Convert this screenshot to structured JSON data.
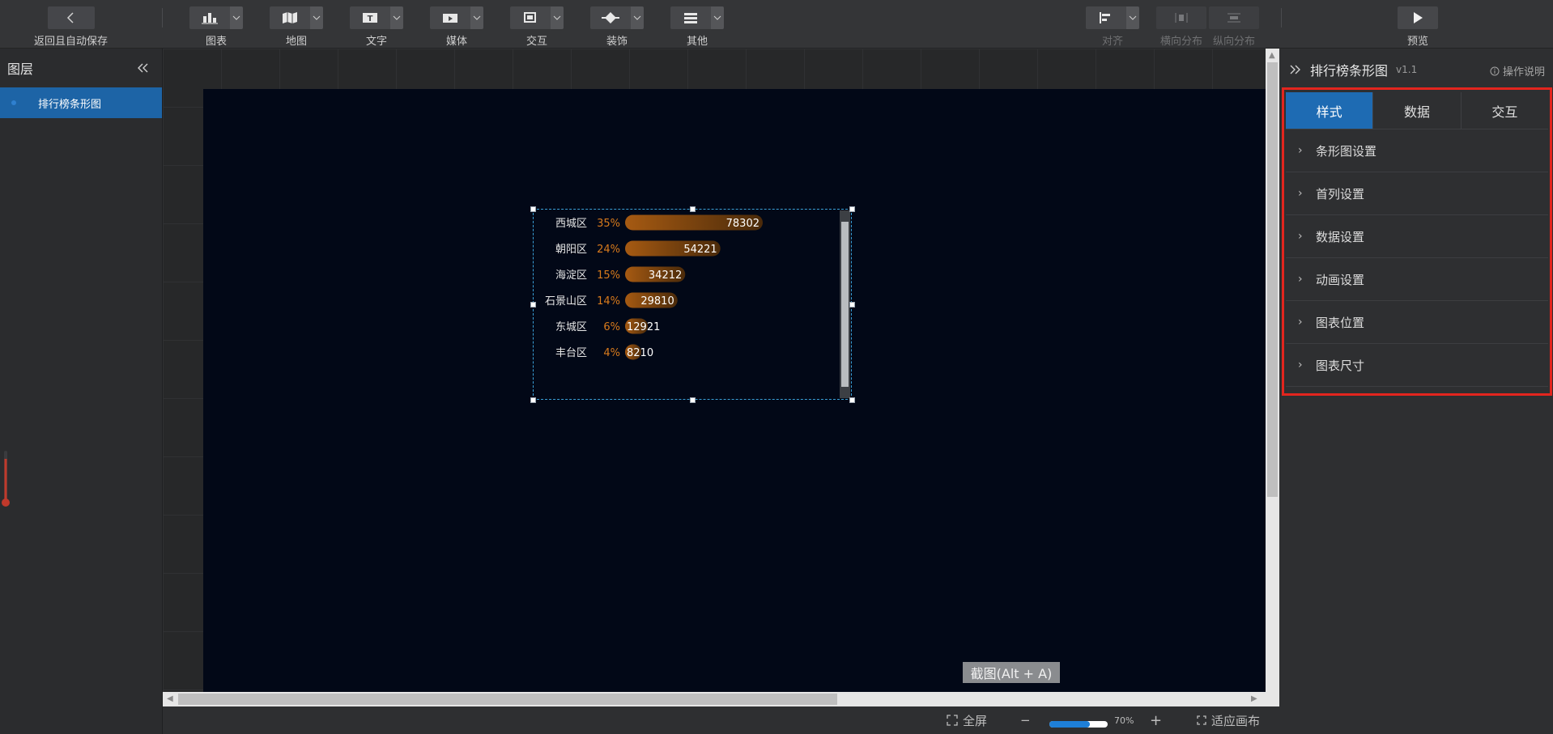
{
  "toolbar": {
    "back_label": "返回且自动保存",
    "groups": [
      {
        "label": "图表",
        "icon": "chart-icon"
      },
      {
        "label": "地图",
        "icon": "map-icon"
      },
      {
        "label": "文字",
        "icon": "text-icon"
      },
      {
        "label": "媒体",
        "icon": "media-icon"
      },
      {
        "label": "交互",
        "icon": "interaction-icon"
      },
      {
        "label": "装饰",
        "icon": "decoration-icon"
      },
      {
        "label": "其他",
        "icon": "other-icon"
      }
    ],
    "align_label": "对齐",
    "h_distribute_label": "横向分布",
    "v_distribute_label": "纵向分布",
    "preview_label": "预览"
  },
  "layers": {
    "title": "图层",
    "items": [
      {
        "label": "排行榜条形图"
      }
    ]
  },
  "chart_data": {
    "type": "bar",
    "categories": [
      "西城区",
      "朝阳区",
      "海淀区",
      "石景山区",
      "东城区",
      "丰台区"
    ],
    "percents": [
      "35%",
      "24%",
      "15%",
      "14%",
      "6%",
      "4%"
    ],
    "values": [
      78302,
      54221,
      34212,
      29810,
      12921,
      8210
    ],
    "bar_color_start": "#a65a12",
    "bar_color_end": "#4a2a0a",
    "percent_color": "#d97b1c"
  },
  "canvas": {
    "screenshot_tip": "截图(Alt + A)"
  },
  "bottom": {
    "fullscreen_label": "全屏",
    "zoom_value": "70%",
    "zoom_fraction": 0.7,
    "fit_label": "适应画布"
  },
  "right_panel": {
    "title": "排行榜条形图",
    "version": "v1.1",
    "help_label": "操作说明",
    "tabs": [
      {
        "label": "样式"
      },
      {
        "label": "数据"
      },
      {
        "label": "交互"
      }
    ],
    "sections": [
      {
        "label": "条形图设置"
      },
      {
        "label": "首列设置"
      },
      {
        "label": "数据设置"
      },
      {
        "label": "动画设置"
      },
      {
        "label": "图表位置"
      },
      {
        "label": "图表尺寸"
      }
    ],
    "accent": "#1e6bb3",
    "highlight": "#e3251e"
  }
}
